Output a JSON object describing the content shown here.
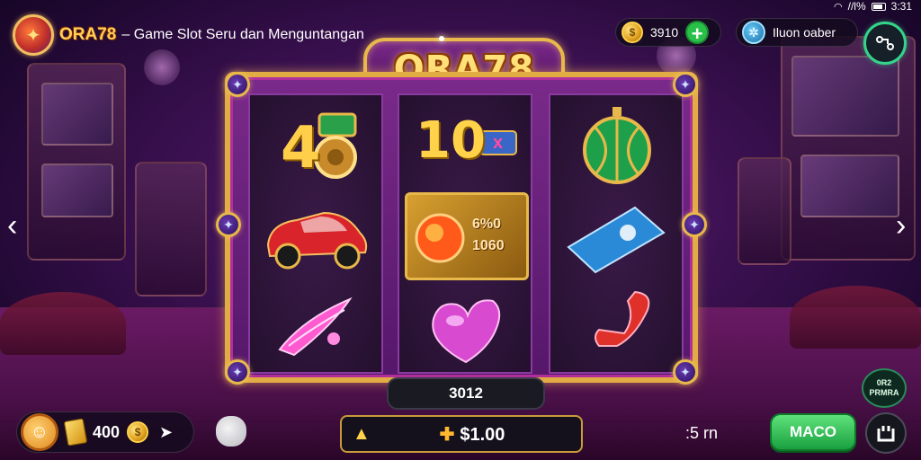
{
  "status_bar": {
    "signal_text": "//l%",
    "time": "3:31"
  },
  "header": {
    "brand_name": "ORA78",
    "tagline": "– Game Slot Seru dan Menguntangan",
    "coins_value": "3910",
    "leaderboard_label": "Iluon oaber",
    "logo_text": "ORA78"
  },
  "reels": [
    {
      "symbols": [
        {
          "icon": "golden-4-symbol",
          "text": "4"
        },
        {
          "icon": "red-car-symbol",
          "text": ""
        },
        {
          "icon": "pink-feather-symbol",
          "text": ""
        }
      ]
    },
    {
      "symbols": [
        {
          "icon": "10x-multiplier-symbol",
          "text": "10",
          "sub": "x"
        },
        {
          "icon": "fireball-jackpot-symbol",
          "line1": "6%0",
          "line2": "1060"
        },
        {
          "icon": "purple-heart-symbol",
          "text": ""
        }
      ]
    },
    {
      "symbols": [
        {
          "icon": "green-lantern-symbol",
          "text": ""
        },
        {
          "icon": "blue-ticket-symbol",
          "text": ""
        },
        {
          "icon": "red-ribbon-symbol",
          "text": ""
        }
      ]
    }
  ],
  "bet_display": "3012",
  "footer": {
    "balance": "400",
    "win_value": "$1.00",
    "lines_text": ":5 rn",
    "spin_label": "MACO",
    "badge_line1": "0R2",
    "badge_line2": "PRMRA"
  },
  "colors": {
    "accent_gold": "#e2ac45",
    "spin_green": "#1aa040",
    "frame_purple": "#7a2a8a"
  }
}
